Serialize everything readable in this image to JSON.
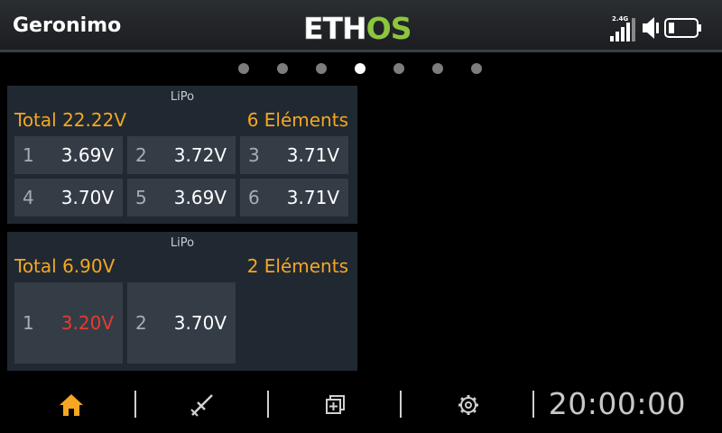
{
  "header": {
    "model_name": "Geronimo",
    "logo_text": "ETHOS",
    "radio_band": "2.4G"
  },
  "pager": {
    "count": 7,
    "active_index": 3
  },
  "widgets": [
    {
      "type": "LiPo",
      "total": "Total 22.22V",
      "cells_label": "6 Eléments",
      "cells": [
        {
          "num": "1",
          "value": "3.69V",
          "low": false
        },
        {
          "num": "2",
          "value": "3.72V",
          "low": false
        },
        {
          "num": "3",
          "value": "3.71V",
          "low": false
        },
        {
          "num": "4",
          "value": "3.70V",
          "low": false
        },
        {
          "num": "5",
          "value": "3.69V",
          "low": false
        },
        {
          "num": "6",
          "value": "3.71V",
          "low": false
        }
      ]
    },
    {
      "type": "LiPo",
      "total": "Total 6.90V",
      "cells_label": "2 Eléments",
      "cells": [
        {
          "num": "1",
          "value": "3.20V",
          "low": true
        },
        {
          "num": "2",
          "value": "3.70V",
          "low": false
        }
      ]
    }
  ],
  "bottom_bar": {
    "items": [
      {
        "name": "home-icon",
        "active": true
      },
      {
        "name": "model-setup-icon",
        "active": false
      },
      {
        "name": "widget-config-icon",
        "active": false
      },
      {
        "name": "system-settings-icon",
        "active": false
      }
    ],
    "clock": "20:00:00"
  },
  "colors": {
    "accent": "#f5a623",
    "low_cell": "#e53b2f",
    "widget_bg": "#202932",
    "cell_bg": "#343d46",
    "logo_green": "#8cc63f"
  }
}
